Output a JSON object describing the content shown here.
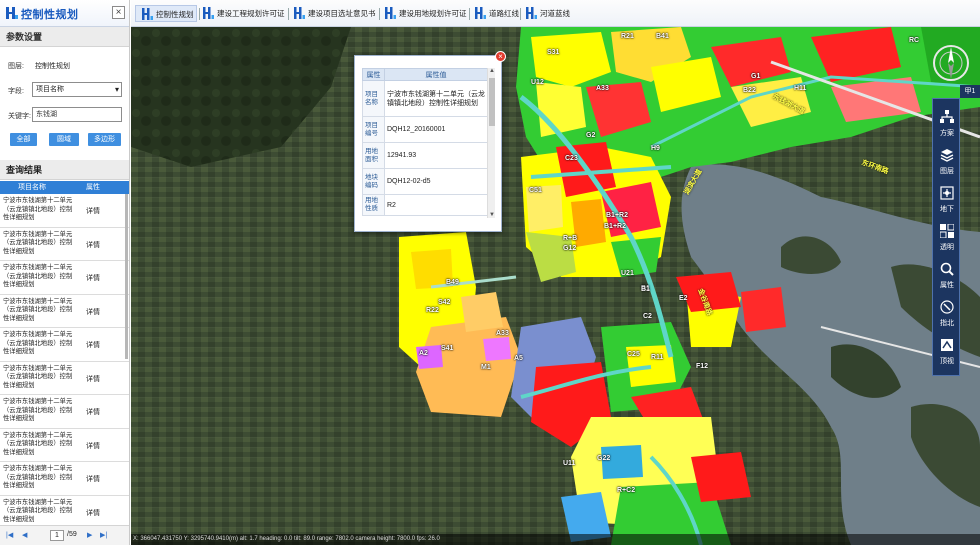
{
  "app": {
    "title": "控制性规划",
    "close_label": "×"
  },
  "params": {
    "section_title": "参数设置",
    "layer_label": "图层:",
    "layer_value": "控制性规划",
    "field_label": "字段:",
    "field_value": "项目名称",
    "keyword_label": "关键字:",
    "keyword_value": "东钱湖",
    "buttons": {
      "all": "全部",
      "circle": "圆域",
      "polygon": "多边形"
    }
  },
  "results": {
    "section_title": "查询结果",
    "col_name": "项目名称",
    "col_attr": "属性",
    "rows": [
      {
        "name": "宁波市东钱湖第十二单元（云龙镇镇北地段）控制性详细规划",
        "action": "详情"
      },
      {
        "name": "宁波市东钱湖第十二单元（云龙镇镇北地段）控制性详细规划",
        "action": "详情"
      },
      {
        "name": "宁波市东钱湖第十二单元（云龙镇镇北地段）控制性详细规划",
        "action": "详情"
      },
      {
        "name": "宁波市东钱湖第十二单元（云龙镇镇北地段）控制性详细规划",
        "action": "详情"
      },
      {
        "name": "宁波市东钱湖第十二单元（云龙镇镇北地段）控制性详细规划",
        "action": "详情"
      },
      {
        "name": "宁波市东钱湖第十二单元（云龙镇镇北地段）控制性详细规划",
        "action": "详情"
      },
      {
        "name": "宁波市东钱湖第十二单元（云龙镇镇北地段）控制性详细规划",
        "action": "详情"
      },
      {
        "name": "宁波市东钱湖第十二单元（云龙镇镇北地段）控制性详细规划",
        "action": "详情"
      },
      {
        "name": "宁波市东钱湖第十二单元（云龙镇镇北地段）控制性详细规划",
        "action": "详情"
      },
      {
        "name": "宁波市东钱湖第十二单元（云龙镇镇北地段）控制性详细规划",
        "action": "详情"
      }
    ]
  },
  "pager": {
    "first": "|◀",
    "prev": "◀",
    "page": "1",
    "total": "/59",
    "next": "▶",
    "last": "▶|"
  },
  "tabs": [
    {
      "label": "控制性规划",
      "active": true
    },
    {
      "label": "建设工程规划许可证"
    },
    {
      "label": "建设项目选址意见书"
    },
    {
      "label": "建设用地规划许可证"
    },
    {
      "label": "道路红线"
    },
    {
      "label": "河道蓝线"
    }
  ],
  "popup": {
    "close": "×",
    "header_key": "属性",
    "header_val": "属性值",
    "rows": [
      {
        "key": "项目名称",
        "value": "宁波市东钱湖第十二单元（云龙镇镇北地段）控制性详细规划"
      },
      {
        "key": "项目编号",
        "value": "DQH12_20160001"
      },
      {
        "key": "用地面积",
        "value": "12941.93"
      },
      {
        "key": "地块编码",
        "value": "DQH12-02-d5"
      },
      {
        "key": "用地性质",
        "value": "R2"
      }
    ]
  },
  "toolbar": {
    "tab_label": "甲1",
    "tools": [
      {
        "label": "方案",
        "icon": "scheme-icon"
      },
      {
        "label": "图层",
        "icon": "layers-icon"
      },
      {
        "label": "地下",
        "icon": "underground-icon"
      },
      {
        "label": "透明",
        "icon": "transparency-icon"
      },
      {
        "label": "属性",
        "icon": "search-icon"
      },
      {
        "label": "指北",
        "icon": "north-icon"
      },
      {
        "label": "顶视",
        "icon": "topview-icon"
      }
    ]
  },
  "map_labels": [
    "S31",
    "R21",
    "B41",
    "U12",
    "A33",
    "G1",
    "B22",
    "H11",
    "RC",
    "C23",
    "G2",
    "H9",
    "C51",
    "R+B",
    "B1+R2",
    "G12",
    "U21",
    "B1",
    "E2",
    "B49",
    "R22",
    "S42",
    "A33",
    "A5",
    "A2",
    "S41",
    "M1",
    "C25",
    "R11",
    "F12",
    "G22",
    "U11",
    "R+C2",
    "B1+R2",
    "C2",
    "B1"
  ],
  "road_labels": [
    "东钱湖大道",
    "湖滨大道",
    "东环南路",
    "金谷南路"
  ],
  "status": "X: 366047.431750   Y: 3295740.9410(m)   alt: 1.7   heading: 0.0   tilt: 89.0   range: 7802.0   camera height: 7800.0   fps: 26.0",
  "colors": {
    "primary_blue": "#2f7fd6",
    "residential_yellow": "#ffff00",
    "commercial_red": "#ff1a1a",
    "green_space": "#33cc33",
    "water_cyan": "#66e0e0",
    "toolbar_navy": "#1c3560"
  }
}
